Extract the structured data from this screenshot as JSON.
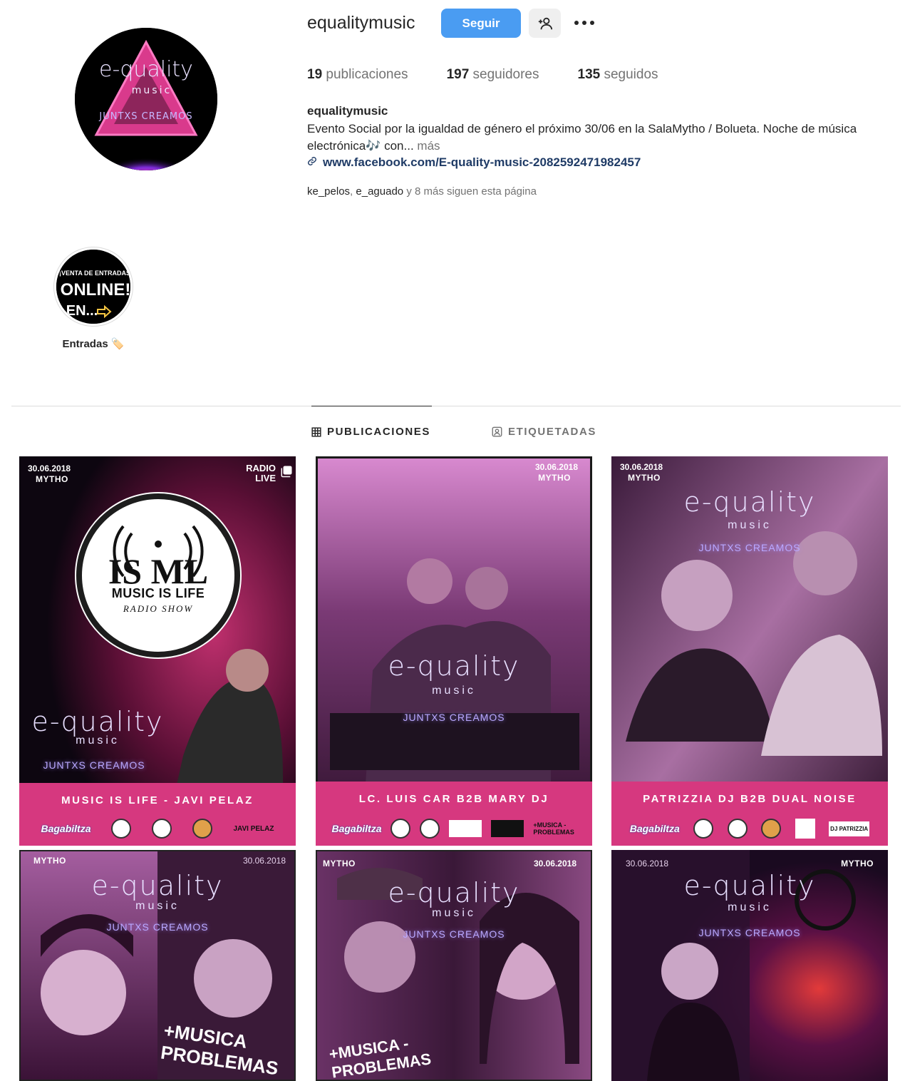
{
  "profile": {
    "username": "equalitymusic",
    "follow_label": "Seguir",
    "stats": {
      "posts_count": "19",
      "posts_label": "publicaciones",
      "followers_count": "197",
      "followers_label": "seguidores",
      "following_count": "135",
      "following_label": "seguidos"
    },
    "full_name": "equalitymusic",
    "bio": "Evento Social por la igualdad de género el próximo 30/06 en la SalaMytho / Bolueta. Noche de música electrónica🎶 con...",
    "bio_more": "más",
    "link": "www.facebook.com/E-quality-music-2082592471982457",
    "followed_by_users": [
      "ke_pelos",
      "e_aguado"
    ],
    "followed_by_sep": ", ",
    "followed_by_suffix": "y 8 más siguen esta página",
    "avatar": {
      "brand_line1": "e-quality",
      "brand_line2": "music",
      "tagline": "JUNTXS CREAMOS"
    }
  },
  "highlight": {
    "label": "Entradas 🏷️",
    "cover_line1": "¡VENTA DE ENTRADAS",
    "cover_line2": "ONLINE!",
    "cover_line3": "EN..."
  },
  "tabs": [
    {
      "label": "PUBLICACIONES",
      "icon": "grid-icon",
      "active": true
    },
    {
      "label": "ETIQUETADAS",
      "icon": "tagged-icon",
      "active": false
    }
  ],
  "posts": [
    {
      "date": "30.06.2018",
      "venue": "MYTHO",
      "corner": "RADIO\nLIVE",
      "badge_title": "MUSIC IS LIFE",
      "badge_sub": "RADIO SHOW",
      "badge_letters": "IS ML",
      "brand": "e-quality",
      "brand_sub": "music",
      "tagline": "JUNTXS CREAMOS",
      "band": "MUSIC IS LIFE - JAVI PELAZ",
      "logo_text": "Bagabiltza",
      "logo_text2": "JAVI PELAZ",
      "multi": true
    },
    {
      "date": "30.06.2018",
      "venue": "MYTHO",
      "brand": "e-quality",
      "brand_sub": "music",
      "tagline": "JUNTXS CREAMOS",
      "band": "LC. LUIS CAR  B2B  MARY DJ",
      "logo_text": "Bagabiltza",
      "logo_text2": "+MUSICA -PROBLEMAS"
    },
    {
      "date": "30.06.2018",
      "venue": "MYTHO",
      "brand": "e-quality",
      "brand_sub": "music",
      "tagline": "JUNTXS CREAMOS",
      "band": "PATRIZZIA DJ  B2B  DUAL NOISE",
      "logo_text": "Bagabiltza",
      "logo_text2": "DJ PATRIZZIA"
    },
    {
      "date": "30.06.2018",
      "venue": "MYTHO",
      "brand": "e-quality",
      "brand_sub": "music",
      "tagline": "JUNTXS CREAMOS",
      "overlay": "+MUSICA PROBLEMAS"
    },
    {
      "date": "30.06.2018",
      "venue": "MYTHO",
      "brand": "e-quality",
      "brand_sub": "music",
      "tagline": "JUNTXS CREAMOS",
      "overlay": "+MUSICA -PROBLEMAS"
    },
    {
      "date": "30.06.2018",
      "venue": "MYTHO",
      "brand": "e-quality",
      "brand_sub": "music",
      "tagline": "JUNTXS CREAMOS"
    }
  ],
  "colors": {
    "follow_button": "#4a9cf2",
    "link": "#1f3b66",
    "band_pink": "#d6387f",
    "muted_text": "#737373"
  }
}
